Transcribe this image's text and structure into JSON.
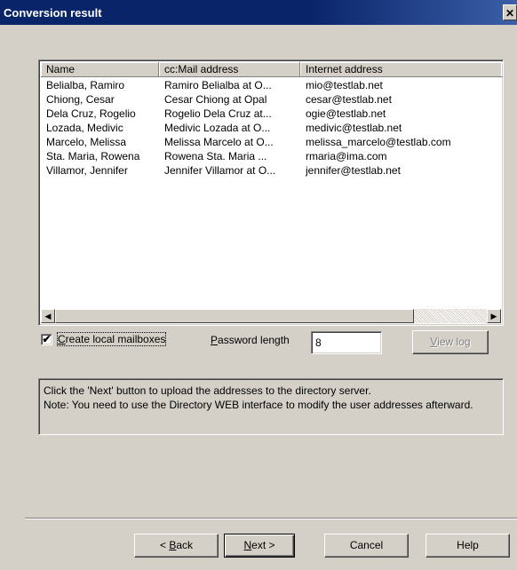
{
  "window": {
    "title": "Conversion result",
    "close_glyph": "✕"
  },
  "listview": {
    "columns": [
      "Name",
      "cc:Mail address",
      "Internet address"
    ],
    "rows": [
      [
        "Belialba, Ramiro",
        "Ramiro Belialba at O...",
        "mio@testlab.net"
      ],
      [
        "Chiong, Cesar",
        "Cesar Chiong at Opal",
        "cesar@testlab.net"
      ],
      [
        "Dela Cruz, Rogelio",
        "Rogelio Dela Cruz at...",
        "ogie@testlab.net"
      ],
      [
        "Lozada, Medivic",
        "Medivic Lozada at O...",
        "medivic@testlab.net"
      ],
      [
        "Marcelo, Melissa",
        "Melissa Marcelo at O...",
        "melissa_marcelo@testlab.com"
      ],
      [
        "Sta. Maria, Rowena",
        "Rowena Sta. Maria ...",
        "rmaria@ima.com"
      ],
      [
        "Villamor, Jennifer",
        "Jennifer Villamor at O...",
        "jennifer@testlab.net"
      ]
    ]
  },
  "options": {
    "create_mailboxes_first": "C",
    "create_mailboxes_rest": "reate local mailboxes",
    "create_mailboxes_checked": true,
    "password_first": "P",
    "password_rest": "assword length",
    "password_value": "8",
    "view_log_first": "V",
    "view_log_rest": "iew log"
  },
  "info": {
    "lines": [
      "Click the 'Next' button to upload the addresses to the directory server.",
      "Note: You need to use the Directory WEB interface to modify the user addresses afterward."
    ]
  },
  "buttons": {
    "back_prefix": "< ",
    "back_key": "B",
    "back_rest": "ack",
    "next_key": "N",
    "next_rest": "ext >",
    "cancel": "Cancel",
    "help": "Help"
  },
  "icons": {
    "scroll_left": "◀",
    "scroll_right": "▶",
    "checkmark": "✔"
  }
}
